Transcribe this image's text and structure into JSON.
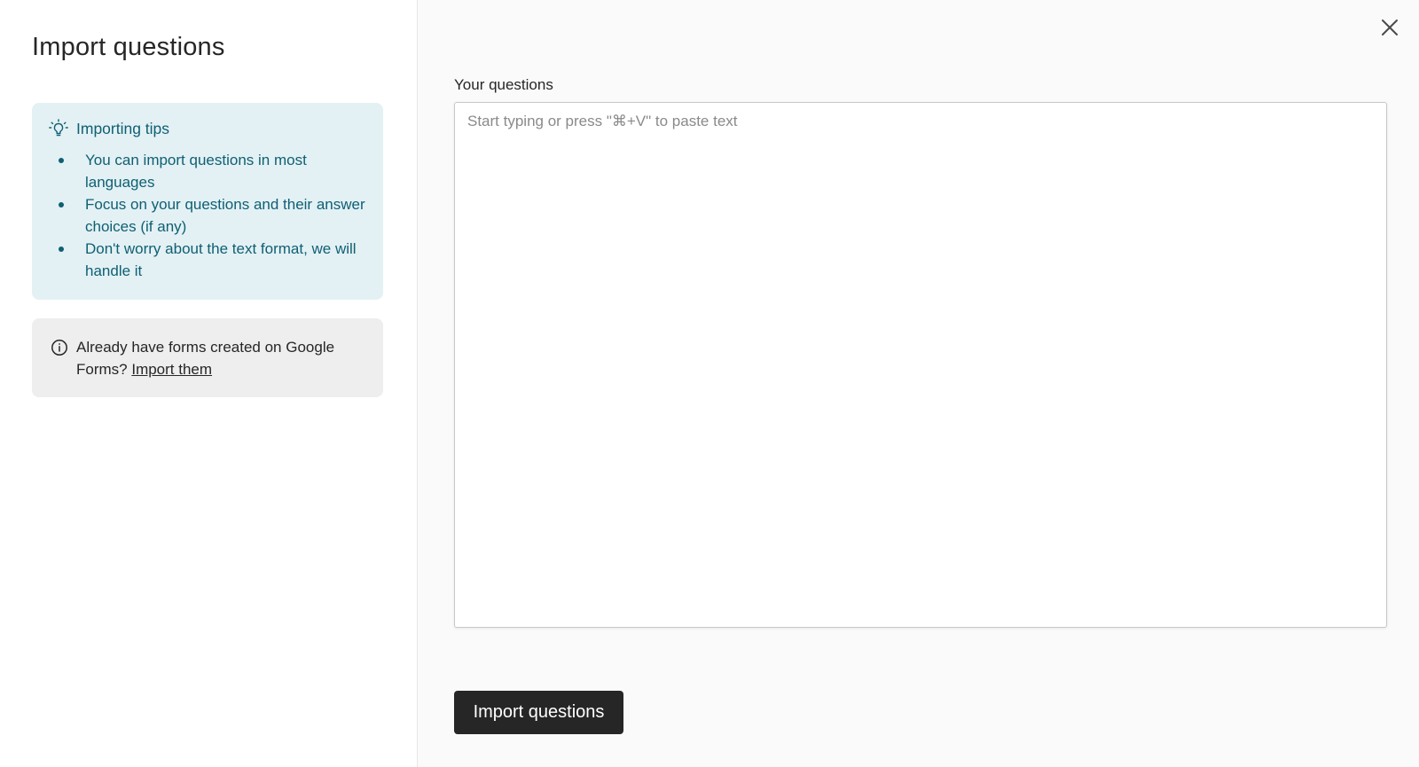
{
  "left_panel": {
    "title": "Import questions",
    "tips": {
      "title": "Importing tips",
      "icon": "lightbulb-icon",
      "items": [
        "You can import questions in most languages",
        "Focus on your questions and their answer choices (if any)",
        "Don't worry about the text format, we will handle it"
      ]
    },
    "google_forms": {
      "icon": "info-icon",
      "text": "Already have forms created on Google Forms? ",
      "link_label": "Import them"
    }
  },
  "main": {
    "close_icon": "close-icon",
    "field_label": "Your questions",
    "textarea": {
      "value": "",
      "placeholder": "Start typing or press \"⌘+V\" to paste text"
    },
    "submit_label": "Import questions"
  },
  "colors": {
    "tips_background": "#e3f1f4",
    "tips_text": "#0f5f73",
    "info_background": "#eeeeee",
    "button_background": "#262627",
    "page_background": "#fafafa"
  }
}
